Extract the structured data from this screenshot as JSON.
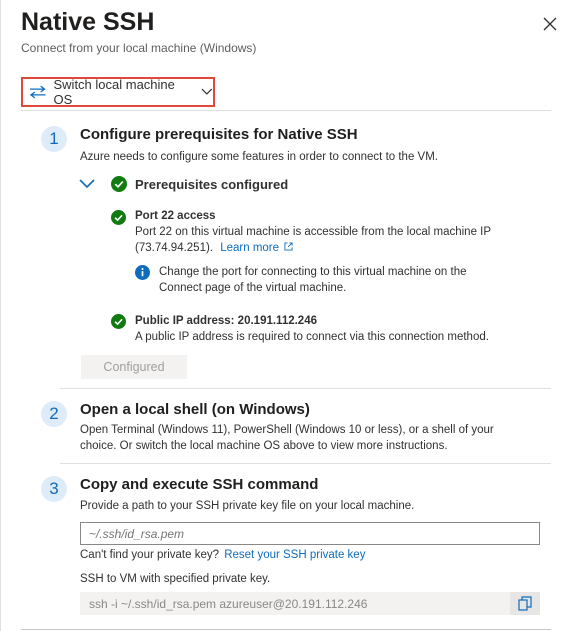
{
  "header": {
    "title": "Native SSH",
    "subtitle": "Connect from your local machine (Windows)"
  },
  "switch_os": {
    "label": "Switch local machine OS"
  },
  "steps": [
    {
      "number": "1",
      "title": "Configure prerequisites for Native SSH",
      "description": "Azure needs to configure some features in order to connect to the VM.",
      "prereq_header": "Prerequisites configured",
      "items": [
        {
          "title": "Port 22 access",
          "desc_line1": "Port 22 on this virtual machine is accessible from the local machine IP",
          "desc_line2": "(73.74.94.251).",
          "link": "Learn more",
          "info_line1": "Change the port for connecting to this virtual machine on the",
          "info_line2": "Connect page of the virtual machine."
        },
        {
          "title": "Public IP address: 20.191.112.246",
          "desc_line1": "A public IP address is required to connect via this connection method."
        }
      ],
      "button": "Configured"
    },
    {
      "number": "2",
      "title": "Open a local shell (on Windows)",
      "desc_line1": "Open Terminal (Windows 11), PowerShell (Windows 10 or less), or a shell of your",
      "desc_line2": "choice. Or switch the local machine OS above to view more instructions."
    },
    {
      "number": "3",
      "title": "Copy and execute SSH command",
      "description": "Provide a path to your SSH private key file on your local machine.",
      "input_placeholder": "~/.ssh/id_rsa.pem",
      "help_text": "Can't find your private key?",
      "help_link": "Reset your SSH private key",
      "cmd_label": "SSH to VM with specified private key.",
      "command": "ssh -i ~/.ssh/id_rsa.pem azureuser@20.191.112.246"
    }
  ],
  "icons": {
    "close": "close-icon",
    "switch": "swap-arrows-icon",
    "chevron": "chevron-down-icon",
    "check": "check-circle-icon",
    "info": "info-icon",
    "external": "external-link-icon",
    "copy": "copy-icon"
  },
  "colors": {
    "accent": "#0f6cbd",
    "success": "#107c10",
    "highlight_border": "#e0483a"
  }
}
